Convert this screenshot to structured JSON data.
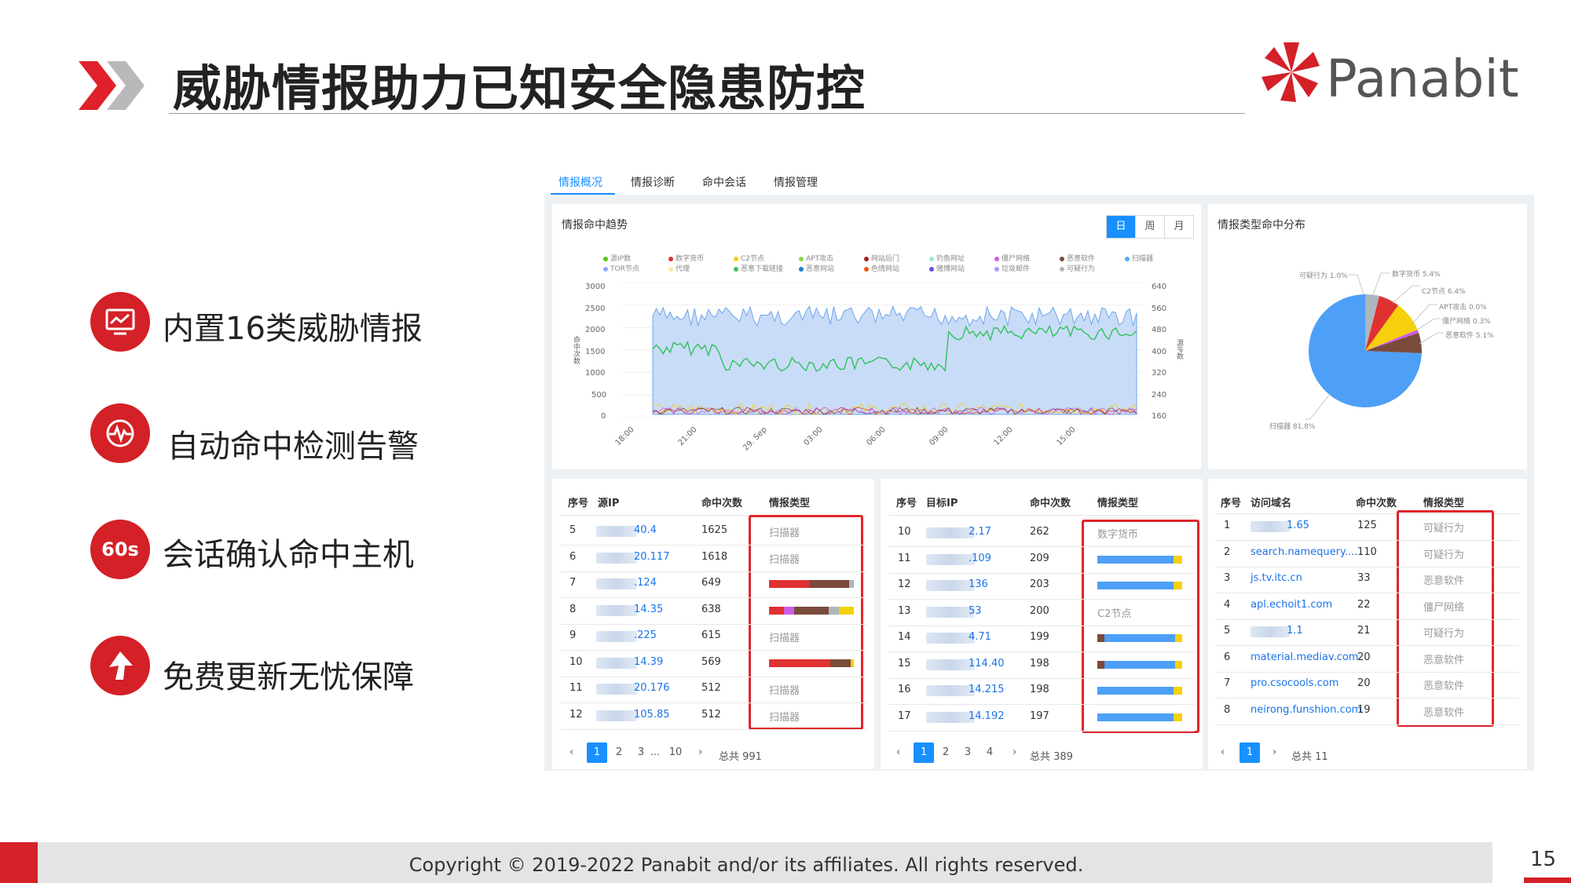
{
  "slide": {
    "title": "威胁情报助力已知安全隐患防控",
    "logo_text": "Panabit",
    "footer": "Copyright © 2019-2022 Panabit and/or its affiliates. All rights reserved.",
    "page_number": "15",
    "brand_color": "#d42027"
  },
  "features": [
    {
      "icon": "monitor-icon",
      "badge": "",
      "label": "内置16类威胁情报"
    },
    {
      "icon": "pulse-icon",
      "badge": "",
      "label": "自动命中检测告警"
    },
    {
      "icon": "timer-badge",
      "badge": "60s",
      "label": "会话确认命中主机"
    },
    {
      "icon": "arrow-up-icon",
      "badge": "",
      "label": "免费更新无忧保障"
    }
  ],
  "dashboard": {
    "tabs": [
      "情报概况",
      "情报诊断",
      "命中会话",
      "情报管理"
    ],
    "active_tab": 0,
    "trend": {
      "title": "情报命中趋势",
      "periods": [
        "日",
        "周",
        "月"
      ],
      "active_period": 0,
      "legend_row1": [
        {
          "name": "源IP数",
          "color": "#52c41a"
        },
        {
          "name": "数字货币",
          "color": "#e03131"
        },
        {
          "name": "C2节点",
          "color": "#f5d00b"
        },
        {
          "name": "APT攻击",
          "color": "#91d44a"
        },
        {
          "name": "网站后门",
          "color": "#a61e1e"
        },
        {
          "name": "钓鱼网址",
          "color": "#99e9d5"
        },
        {
          "name": "僵尸网络",
          "color": "#cc5de8"
        },
        {
          "name": "恶意软件",
          "color": "#7a4a3a"
        },
        {
          "name": "扫描器",
          "color": "#4dabf7"
        }
      ],
      "legend_row2": [
        {
          "name": "TOR节点",
          "color": "#91a7ff"
        },
        {
          "name": "代理",
          "color": "#ffe8a3"
        },
        {
          "name": "恶意下载链接",
          "color": "#40c057"
        },
        {
          "name": "恶意网站",
          "color": "#1c7ed6"
        },
        {
          "name": "色情网站",
          "color": "#e8590c"
        },
        {
          "name": "赌博网站",
          "color": "#7048e8"
        },
        {
          "name": "垃圾邮件",
          "color": "#b197fc"
        },
        {
          "name": "可疑行为",
          "color": "#adb5bd"
        }
      ],
      "y_left_ticks": [
        "3000",
        "2500",
        "2000",
        "1500",
        "1000",
        "500",
        "0"
      ],
      "y_right_ticks": [
        "640",
        "560",
        "480",
        "400",
        "320",
        "240",
        "160"
      ],
      "y_left_label": "命中次数",
      "y_right_label": "源IP数",
      "x_ticks": [
        "18:00",
        "21:00",
        "29. Sep",
        "03:00",
        "06:00",
        "09:00",
        "12:00",
        "15:00"
      ]
    },
    "pie": {
      "title": "情报类型命中分布",
      "labels": [
        "可疑行为 1.0%",
        "数字货币 5.4%",
        "C2节点 6.4%",
        "APT攻击 0.0%",
        "僵尸网络 0.3%",
        "恶意软件 5.1%",
        "扫描器 81.8%"
      ]
    },
    "table1": {
      "headers": [
        "序号",
        "源IP",
        "命中次数",
        "情报类型"
      ],
      "rows": [
        {
          "idx": "5",
          "ip": "40.4",
          "hits": "1625",
          "type": "扫描器"
        },
        {
          "idx": "6",
          "ip": "20.117",
          "hits": "1618",
          "type": "扫描器"
        },
        {
          "idx": "7",
          "ip": ".124",
          "hits": "649",
          "type": ""
        },
        {
          "idx": "8",
          "ip": "14.35",
          "hits": "638",
          "type": ""
        },
        {
          "idx": "9",
          "ip": ".225",
          "hits": "615",
          "type": "扫描器"
        },
        {
          "idx": "10",
          "ip": "14.39",
          "hits": "569",
          "type": ""
        },
        {
          "idx": "11",
          "ip": "20.176",
          "hits": "512",
          "type": "扫描器"
        },
        {
          "idx": "12",
          "ip": "105.85",
          "hits": "512",
          "type": "扫描器"
        }
      ],
      "pages": [
        "1",
        "2",
        "3",
        "...",
        "10"
      ],
      "total": "总共 991"
    },
    "table2": {
      "headers": [
        "序号",
        "目标IP",
        "命中次数",
        "情报类型"
      ],
      "rows": [
        {
          "idx": "10",
          "ip": "2.17",
          "hits": "262",
          "type": "数字货币"
        },
        {
          "idx": "11",
          "ip": ".109",
          "hits": "209",
          "type": ""
        },
        {
          "idx": "12",
          "ip": "136",
          "hits": "203",
          "type": ""
        },
        {
          "idx": "13",
          "ip": "53",
          "hits": "200",
          "type": "C2节点"
        },
        {
          "idx": "14",
          "ip": "4.71",
          "hits": "199",
          "type": ""
        },
        {
          "idx": "15",
          "ip": "114.40",
          "hits": "198",
          "type": ""
        },
        {
          "idx": "16",
          "ip": "14.215",
          "hits": "198",
          "type": ""
        },
        {
          "idx": "17",
          "ip": "14.192",
          "hits": "197",
          "type": ""
        }
      ],
      "pages": [
        "1",
        "2",
        "3",
        "4"
      ],
      "total": "总共 389"
    },
    "table3": {
      "headers": [
        "序号",
        "访问域名",
        "命中次数",
        "情报类型"
      ],
      "rows": [
        {
          "idx": "1",
          "domain": "1.65",
          "hits": "125",
          "type": "可疑行为"
        },
        {
          "idx": "2",
          "domain": "search.namequery....",
          "hits": "110",
          "type": "可疑行为"
        },
        {
          "idx": "3",
          "domain": "js.tv.itc.cn",
          "hits": "33",
          "type": "恶意软件"
        },
        {
          "idx": "4",
          "domain": "apl.echoit1.com",
          "hits": "22",
          "type": "僵尸网络"
        },
        {
          "idx": "5",
          "domain": "1.1",
          "hits": "21",
          "type": "可疑行为"
        },
        {
          "idx": "6",
          "domain": "material.mediav.com",
          "hits": "20",
          "type": "恶意软件"
        },
        {
          "idx": "7",
          "domain": "pro.csocools.com",
          "hits": "20",
          "type": "恶意软件"
        },
        {
          "idx": "8",
          "domain": "neirong.funshion.com",
          "hits": "19",
          "type": "恶意软件"
        }
      ],
      "pages": [
        "1"
      ],
      "total": "总共 11"
    }
  }
}
